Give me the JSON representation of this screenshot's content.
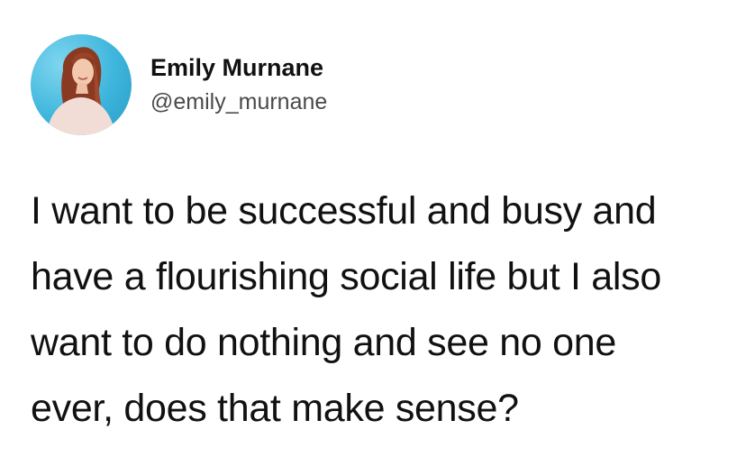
{
  "tweet": {
    "author": {
      "display_name": "Emily Murnane",
      "handle": "@emily_murnane",
      "avatar_icon": "profile-photo"
    },
    "text_lines": [
      "I want to be successful and busy and",
      "have a flourishing social life but I also",
      "want to do nothing and see no one",
      "ever, does that make sense?"
    ]
  },
  "colors": {
    "avatar_background": "#3db5dc",
    "text": "#111111",
    "handle": "#4a4a4a"
  }
}
